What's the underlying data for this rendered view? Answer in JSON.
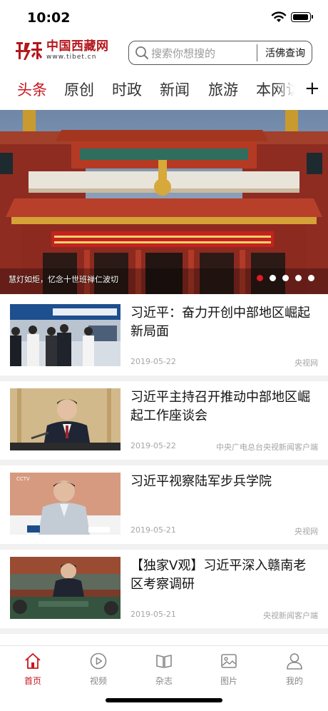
{
  "status_bar": {
    "time": "10:02"
  },
  "header": {
    "logo": {
      "name": "中国西藏网",
      "url": "www.tibet.cn"
    },
    "search": {
      "placeholder": "搜索你想搜的",
      "button_label": "活佛查询"
    }
  },
  "tabs": {
    "items": [
      {
        "label": "头条",
        "active": true
      },
      {
        "label": "原创",
        "active": false
      },
      {
        "label": "时政",
        "active": false
      },
      {
        "label": "新闻",
        "active": false
      },
      {
        "label": "旅游",
        "active": false
      },
      {
        "label": "本网访",
        "active": false
      }
    ],
    "add_label": "+"
  },
  "banner": {
    "caption": "慧灯如炬，忆念十世班禅仁波切",
    "slides_total": 5,
    "active_slide": 1,
    "accent_color": "#e01b22"
  },
  "news": [
    {
      "title": "习近平：奋力开创中部地区崛起新局面",
      "date": "2019-05-22",
      "source": "央视网"
    },
    {
      "title": "习近平主持召开推动中部地区崛起工作座谈会",
      "date": "2019-05-22",
      "source": "中央广电总台央视新闻客户端"
    },
    {
      "title": "习近平视察陆军步兵学院",
      "date": "2019-05-21",
      "source": "央视网"
    },
    {
      "title": "【独家V观】习近平深入赣南老区考察调研",
      "date": "2019-05-21",
      "source": "央视新闻客户端"
    }
  ],
  "tab_bar": {
    "items": [
      {
        "label": "首页",
        "icon": "home-icon",
        "active": true
      },
      {
        "label": "视频",
        "icon": "play-icon",
        "active": false
      },
      {
        "label": "杂志",
        "icon": "book-icon",
        "active": false
      },
      {
        "label": "图片",
        "icon": "picture-icon",
        "active": false
      },
      {
        "label": "我的",
        "icon": "user-icon",
        "active": false
      }
    ]
  },
  "colors": {
    "brand_red": "#c8161d",
    "inactive_gray": "#888888"
  }
}
